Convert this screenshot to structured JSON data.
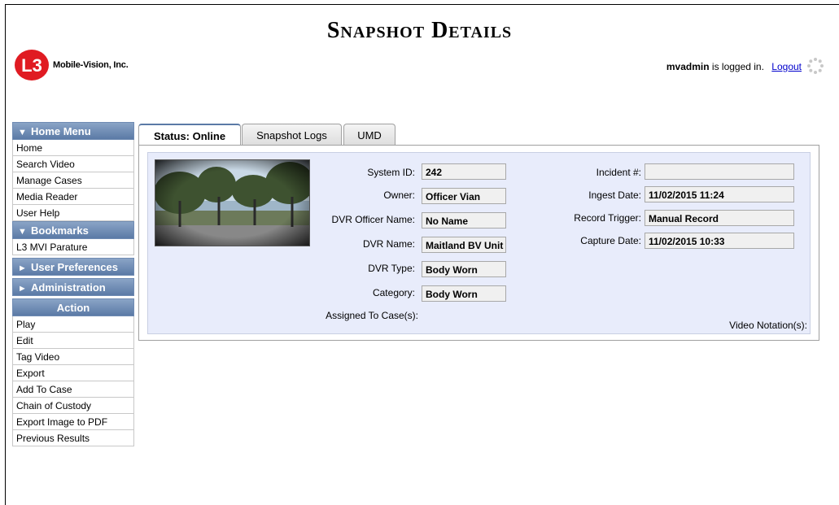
{
  "page": {
    "title": "Snapshot Details"
  },
  "brand": {
    "name": "Mobile-Vision, Inc.",
    "logo_text": "L3",
    "logo_color": "#e01b22"
  },
  "session": {
    "user": "mvadmin",
    "logged_in_text": " is logged in.",
    "logout_label": "Logout"
  },
  "sidebar": {
    "home_menu": {
      "header": "Home Menu",
      "items": [
        "Home",
        "Search Video",
        "Manage Cases",
        "Media Reader",
        "User Help"
      ]
    },
    "bookmarks": {
      "header": "Bookmarks",
      "items": [
        "L3 MVI Parature"
      ]
    },
    "user_preferences": {
      "header": "User Preferences"
    },
    "administration": {
      "header": "Administration"
    },
    "action": {
      "header": "Action",
      "items": [
        "Play",
        "Edit",
        "Tag Video",
        "Export",
        "Add To Case",
        "Chain of Custody",
        "Export Image to PDF",
        "Previous Results"
      ]
    }
  },
  "tabs": [
    "Status: Online",
    "Snapshot Logs",
    "UMD"
  ],
  "details": {
    "left": [
      {
        "label": "System ID:",
        "value": "242"
      },
      {
        "label": "Owner:",
        "value": "Officer Vian"
      },
      {
        "label": "DVR Officer Name:",
        "value": "No Name"
      },
      {
        "label": "DVR Name:",
        "value": "Maitland BV Unit"
      },
      {
        "label": "DVR Type:",
        "value": "Body Worn"
      },
      {
        "label": "Category:",
        "value": "Body Worn"
      }
    ],
    "right": [
      {
        "label": "Incident #:",
        "value": ""
      },
      {
        "label": "Ingest Date:",
        "value": "11/02/2015 11:24"
      },
      {
        "label": "Record Trigger:",
        "value": "Manual Record"
      },
      {
        "label": "Capture Date:",
        "value": "11/02/2015 10:33"
      }
    ],
    "assigned_label": "Assigned To Case(s):",
    "notation_label": "Video Notation(s):"
  },
  "colors": {
    "menu_header": "#5b7aa6",
    "panel_bg": "#e8ecfb",
    "link": "#0000cc"
  }
}
